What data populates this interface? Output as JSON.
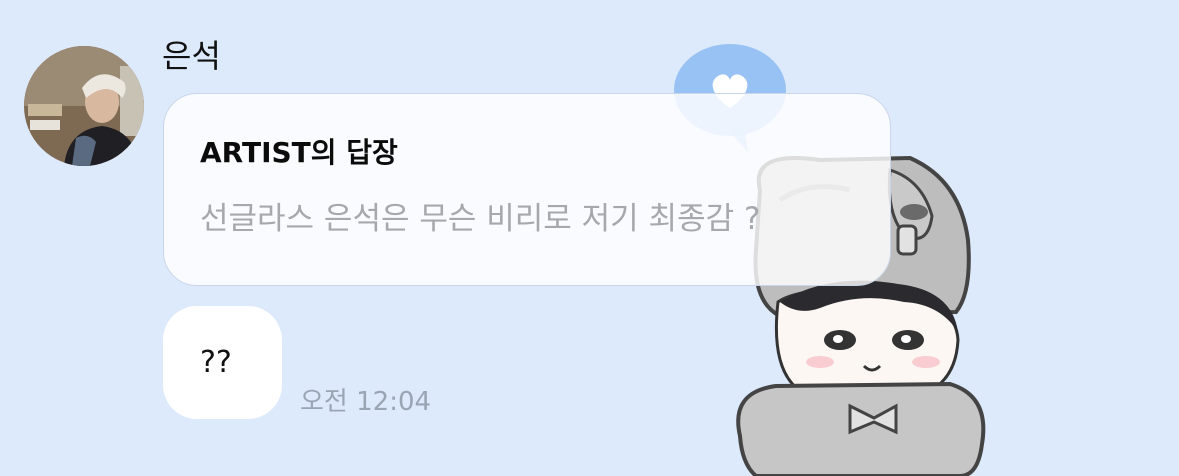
{
  "message": {
    "sender_name": "은석",
    "reply": {
      "title": "ARTIST의 답장",
      "quoted_text": "선글라스 은석은 무슨 비리로 저기 최종감 ?"
    },
    "text": "??",
    "time": "오전 12:04"
  },
  "sticker": {
    "icon": "heart-speech-bubble-icon"
  },
  "colors": {
    "background": "#ddeafb",
    "bubble": "#ffffff",
    "reply_card": "#f8faff",
    "muted_text": "#a6a8ad",
    "timestamp": "#9aa5b3",
    "heart_bubble": "#8dbbf2"
  }
}
